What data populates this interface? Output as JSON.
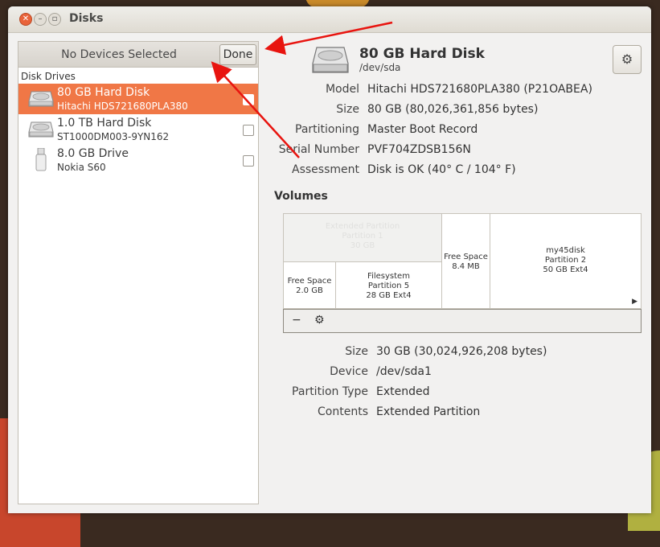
{
  "window": {
    "title": "Disks"
  },
  "sidebar": {
    "selection_label": "No Devices Selected",
    "done_label": "Done",
    "section_label": "Disk Drives",
    "drives": [
      {
        "name": "80 GB Hard Disk",
        "sub": "Hitachi HDS721680PLA380",
        "icon": "hard-disk-icon",
        "selected": true
      },
      {
        "name": "1.0 TB Hard Disk",
        "sub": "ST1000DM003-9YN162",
        "icon": "hard-disk-icon",
        "selected": false
      },
      {
        "name": "8.0 GB Drive",
        "sub": "Nokia S60",
        "icon": "usb-drive-icon",
        "selected": false
      }
    ]
  },
  "disk": {
    "title": "80 GB Hard Disk",
    "device": "/dev/sda",
    "properties": [
      {
        "key": "Model",
        "value": "Hitachi HDS721680PLA380 (P21OABEA)"
      },
      {
        "key": "Size",
        "value": "80 GB (80,026,361,856 bytes)"
      },
      {
        "key": "Partitioning",
        "value": "Master Boot Record"
      },
      {
        "key": "Serial Number",
        "value": "PVF704ZDSB156N"
      },
      {
        "key": "Assessment",
        "value": "Disk is OK (40° C / 104° F)"
      }
    ]
  },
  "volumes": {
    "title": "Volumes",
    "extended": {
      "line1": "Extended Partition",
      "line2": "Partition 1",
      "line3": "30 GB"
    },
    "free1": {
      "line1": "Free Space",
      "line2": "2.0 GB"
    },
    "fs": {
      "line1": "Filesystem",
      "line2": "Partition 5",
      "line3": "28 GB Ext4"
    },
    "free2": {
      "line1": "Free Space",
      "line2": "8.4 MB"
    },
    "part2": {
      "line1": "my45disk",
      "line2": "Partition 2",
      "line3": "50 GB Ext4"
    },
    "toolbar": {
      "remove": "−",
      "settings": "⚙"
    }
  },
  "partition": {
    "properties": [
      {
        "key": "Size",
        "value": "30 GB (30,024,926,208 bytes)"
      },
      {
        "key": "Device",
        "value": "/dev/sda1"
      },
      {
        "key": "Partition Type",
        "value": "Extended"
      },
      {
        "key": "Contents",
        "value": "Extended Partition"
      }
    ]
  },
  "colors": {
    "accent": "#f07746",
    "annotation_arrow": "#e8140f"
  }
}
